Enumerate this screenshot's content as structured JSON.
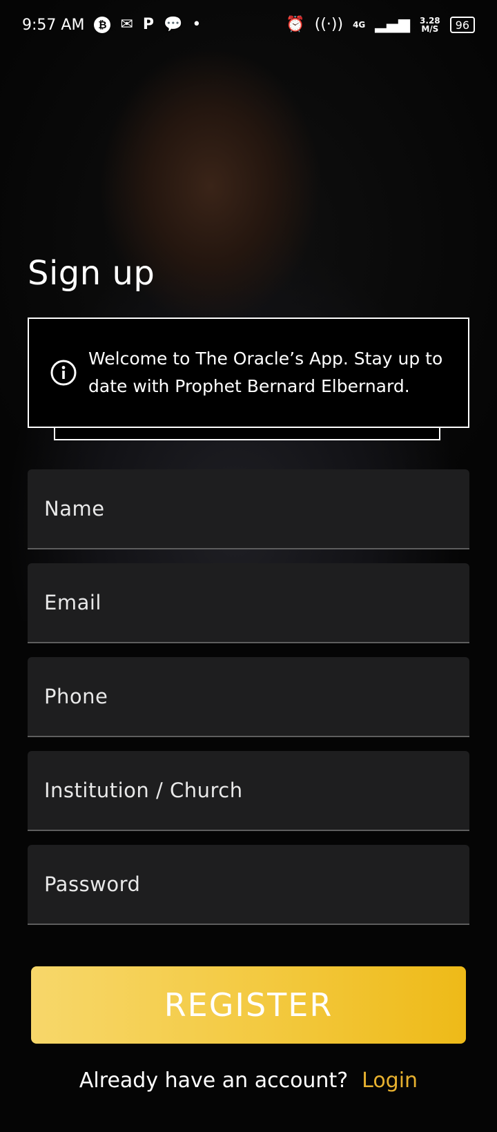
{
  "status_bar": {
    "time": "9:57 AM",
    "left_icons": [
      "bitcoin-icon",
      "gmail-icon",
      "p-app-icon",
      "chat-icon",
      "dot-icon"
    ],
    "network_type": "4G",
    "net_speed_value": "3.28",
    "net_speed_unit": "M/S",
    "battery": "96"
  },
  "page": {
    "title": "Sign up"
  },
  "notice": {
    "icon": "info-icon",
    "message": "Welcome to The Oracle’s App. Stay up to date with Prophet Bernard Elbernard."
  },
  "form": {
    "name_placeholder": "Name",
    "email_placeholder": "Email",
    "phone_placeholder": "Phone",
    "institution_placeholder": "Institution / Church",
    "password_placeholder": "Password",
    "register_label": "REGISTER"
  },
  "footer": {
    "prompt": "Already have an account?",
    "login_label": "Login"
  },
  "colors": {
    "accent_gold": "#eeba18",
    "login_link": "#e7b12f",
    "field_bg": "#1e1e1f"
  }
}
